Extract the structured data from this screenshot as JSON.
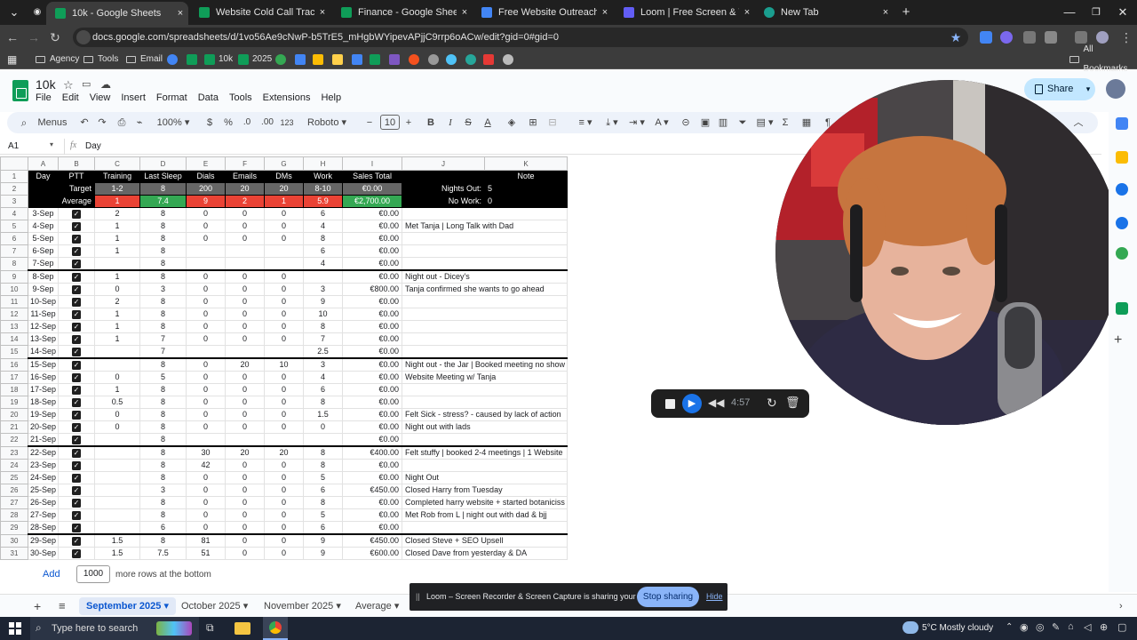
{
  "browser": {
    "tabs": [
      {
        "label": "10k - Google Sheets",
        "active": true,
        "color": "#0f9d58"
      },
      {
        "label": "Website Cold Call Tracking - Go",
        "color": "#0f9d58"
      },
      {
        "label": "Finance - Google Sheets",
        "color": "#0f9d58"
      },
      {
        "label": "Free Website Outreach Scripts",
        "color": "#4285f4"
      },
      {
        "label": "Loom | Free Screen & Video Re",
        "color": "#625df5"
      },
      {
        "label": "New Tab",
        "color": "#1a9e8f"
      }
    ],
    "url": "docs.google.com/spreadsheets/d/1vo56Ae9cNwP-b5TrE5_mHgbWYipevAPjjC9rrp6oACw/edit?gid=0#gid=0",
    "bookmarks": [
      "Agency",
      "Tools",
      "Email",
      "10k",
      "2025"
    ],
    "all_bookmarks": "All Bookmarks"
  },
  "doc": {
    "title": "10k",
    "menu": [
      "File",
      "Edit",
      "View",
      "Insert",
      "Format",
      "Data",
      "Tools",
      "Extensions",
      "Help"
    ],
    "share": "Share",
    "toolbar": {
      "menus": "Menus",
      "zoom": "100%",
      "currency": "$",
      "percent": "%",
      "dec_less": ".0",
      "dec_more": ".00",
      "number_fmt": "123",
      "font": "Roboto",
      "font_size": "10"
    },
    "cell_ref": "A1",
    "formula_value": "Day"
  },
  "sheet": {
    "col_headers": [
      "A",
      "B",
      "C",
      "D",
      "E",
      "F",
      "G",
      "H",
      "I",
      "J",
      "K"
    ],
    "header_row": {
      "day": "Day",
      "ptt": "PTT",
      "training": "Training",
      "sleep": "Last Sleep",
      "dials": "Dials",
      "emails": "Emails",
      "dms": "DMs",
      "work": "Work",
      "sales": "Sales Total",
      "note": "Note"
    },
    "target_row": {
      "label": "Target",
      "training": "1-2",
      "sleep": "8",
      "dials": "200",
      "emails": "20",
      "dms": "20",
      "work": "8-10",
      "sales": "€0.00",
      "note_label": "Nights Out:",
      "note_value": "5"
    },
    "average_row": {
      "label": "Average",
      "training": "1",
      "sleep": "7.4",
      "dials": "9",
      "emails": "2",
      "dms": "1",
      "work": "5.9",
      "sales": "€2,700.00",
      "note_label": "No Work:",
      "note_value": "0"
    },
    "rows": [
      {
        "n": "4",
        "day": "3-Sep",
        "training": "2",
        "sleep": "8",
        "dials": "0",
        "emails": "0",
        "dms": "0",
        "work": "6",
        "sales": "€0.00",
        "note": ""
      },
      {
        "n": "5",
        "day": "4-Sep",
        "training": "1",
        "sleep": "8",
        "dials": "0",
        "emails": "0",
        "dms": "0",
        "work": "4",
        "sales": "€0.00",
        "note": "Met Tanja | Long Talk with Dad"
      },
      {
        "n": "6",
        "day": "5-Sep",
        "training": "1",
        "sleep": "8",
        "dials": "0",
        "emails": "0",
        "dms": "0",
        "work": "8",
        "sales": "€0.00",
        "note": ""
      },
      {
        "n": "7",
        "day": "6-Sep",
        "training": "1",
        "sleep": "8",
        "dials": "",
        "emails": "",
        "dms": "",
        "work": "6",
        "sales": "€0.00",
        "note": ""
      },
      {
        "n": "8",
        "day": "7-Sep",
        "training": "",
        "sleep": "8",
        "dials": "",
        "emails": "",
        "dms": "",
        "work": "4",
        "sales": "€0.00",
        "note": "",
        "wk": true
      },
      {
        "n": "9",
        "day": "8-Sep",
        "training": "1",
        "sleep": "8",
        "dials": "0",
        "emails": "0",
        "dms": "0",
        "work": "",
        "sales": "€0.00",
        "note": "Night out - Dicey's"
      },
      {
        "n": "10",
        "day": "9-Sep",
        "training": "0",
        "sleep": "3",
        "dials": "0",
        "emails": "0",
        "dms": "0",
        "work": "3",
        "sales": "€800.00",
        "note": "Tanja confirmed she wants to go ahead"
      },
      {
        "n": "11",
        "day": "10-Sep",
        "training": "2",
        "sleep": "8",
        "dials": "0",
        "emails": "0",
        "dms": "0",
        "work": "9",
        "sales": "€0.00",
        "note": ""
      },
      {
        "n": "12",
        "day": "11-Sep",
        "training": "1",
        "sleep": "8",
        "dials": "0",
        "emails": "0",
        "dms": "0",
        "work": "10",
        "sales": "€0.00",
        "note": ""
      },
      {
        "n": "13",
        "day": "12-Sep",
        "training": "1",
        "sleep": "8",
        "dials": "0",
        "emails": "0",
        "dms": "0",
        "work": "8",
        "sales": "€0.00",
        "note": ""
      },
      {
        "n": "14",
        "day": "13-Sep",
        "training": "1",
        "sleep": "7",
        "dials": "0",
        "emails": "0",
        "dms": "0",
        "work": "7",
        "sales": "€0.00",
        "note": ""
      },
      {
        "n": "15",
        "day": "14-Sep",
        "training": "",
        "sleep": "7",
        "dials": "",
        "emails": "",
        "dms": "",
        "work": "2.5",
        "sales": "€0.00",
        "note": "",
        "wk": true
      },
      {
        "n": "16",
        "day": "15-Sep",
        "training": "",
        "sleep": "8",
        "dials": "0",
        "emails": "20",
        "dms": "10",
        "work": "3",
        "sales": "€0.00",
        "note": "Night out - the Jar | Booked meeting no show"
      },
      {
        "n": "17",
        "day": "16-Sep",
        "training": "0",
        "sleep": "5",
        "dials": "0",
        "emails": "0",
        "dms": "0",
        "work": "4",
        "sales": "€0.00",
        "note": "Website Meeting w/ Tanja"
      },
      {
        "n": "18",
        "day": "17-Sep",
        "training": "1",
        "sleep": "8",
        "dials": "0",
        "emails": "0",
        "dms": "0",
        "work": "6",
        "sales": "€0.00",
        "note": ""
      },
      {
        "n": "19",
        "day": "18-Sep",
        "training": "0.5",
        "sleep": "8",
        "dials": "0",
        "emails": "0",
        "dms": "0",
        "work": "8",
        "sales": "€0.00",
        "note": ""
      },
      {
        "n": "20",
        "day": "19-Sep",
        "training": "0",
        "sleep": "8",
        "dials": "0",
        "emails": "0",
        "dms": "0",
        "work": "1.5",
        "sales": "€0.00",
        "note": "Felt Sick - stress? - caused by lack of action"
      },
      {
        "n": "21",
        "day": "20-Sep",
        "training": "0",
        "sleep": "8",
        "dials": "0",
        "emails": "0",
        "dms": "0",
        "work": "0",
        "sales": "€0.00",
        "note": "Night out with lads"
      },
      {
        "n": "22",
        "day": "21-Sep",
        "training": "",
        "sleep": "8",
        "dials": "",
        "emails": "",
        "dms": "",
        "work": "",
        "sales": "€0.00",
        "note": "",
        "wk": true
      },
      {
        "n": "23",
        "day": "22-Sep",
        "training": "",
        "sleep": "8",
        "dials": "30",
        "emails": "20",
        "dms": "20",
        "work": "8",
        "sales": "€400.00",
        "note": "Felt stuffy | booked 2-4 meetings | 1 Website"
      },
      {
        "n": "24",
        "day": "23-Sep",
        "training": "",
        "sleep": "8",
        "dials": "42",
        "emails": "0",
        "dms": "0",
        "work": "8",
        "sales": "€0.00",
        "note": ""
      },
      {
        "n": "25",
        "day": "24-Sep",
        "training": "",
        "sleep": "8",
        "dials": "0",
        "emails": "0",
        "dms": "0",
        "work": "5",
        "sales": "€0.00",
        "note": "Night Out"
      },
      {
        "n": "26",
        "day": "25-Sep",
        "training": "",
        "sleep": "3",
        "dials": "0",
        "emails": "0",
        "dms": "0",
        "work": "6",
        "sales": "€450.00",
        "note": "Closed Harry from Tuesday"
      },
      {
        "n": "27",
        "day": "26-Sep",
        "training": "",
        "sleep": "8",
        "dials": "0",
        "emails": "0",
        "dms": "0",
        "work": "8",
        "sales": "€0.00",
        "note": "Completed harry website + started botaniciss"
      },
      {
        "n": "28",
        "day": "27-Sep",
        "training": "",
        "sleep": "8",
        "dials": "0",
        "emails": "0",
        "dms": "0",
        "work": "5",
        "sales": "€0.00",
        "note": "Met Rob from L | night out with dad & bjj"
      },
      {
        "n": "29",
        "day": "28-Sep",
        "training": "",
        "sleep": "6",
        "dials": "0",
        "emails": "0",
        "dms": "0",
        "work": "6",
        "sales": "€0.00",
        "note": "",
        "wk": true
      },
      {
        "n": "30",
        "day": "29-Sep",
        "training": "1.5",
        "sleep": "8",
        "dials": "81",
        "emails": "0",
        "dms": "0",
        "work": "9",
        "sales": "€450.00",
        "note": "Closed Steve + SEO Upsell"
      },
      {
        "n": "31",
        "day": "30-Sep",
        "training": "1.5",
        "sleep": "7.5",
        "dials": "51",
        "emails": "0",
        "dms": "0",
        "work": "9",
        "sales": "€600.00",
        "note": "Closed Dave from yesterday & DA"
      }
    ],
    "add_label": "Add",
    "add_rows_value": "1000",
    "add_rows_suffix": "more rows at the bottom"
  },
  "sheet_tabs": [
    "September 2025",
    "October 2025",
    "November 2025",
    "Average"
  ],
  "loom": {
    "timer": "4:57",
    "share_message": "Loom – Screen Recorder & Screen Capture is sharing your screen.",
    "stop_sharing": "Stop sharing",
    "hide": "Hide"
  },
  "taskbar": {
    "search_placeholder": "Type here to search",
    "weather": "5°C  Mostly cloudy"
  }
}
